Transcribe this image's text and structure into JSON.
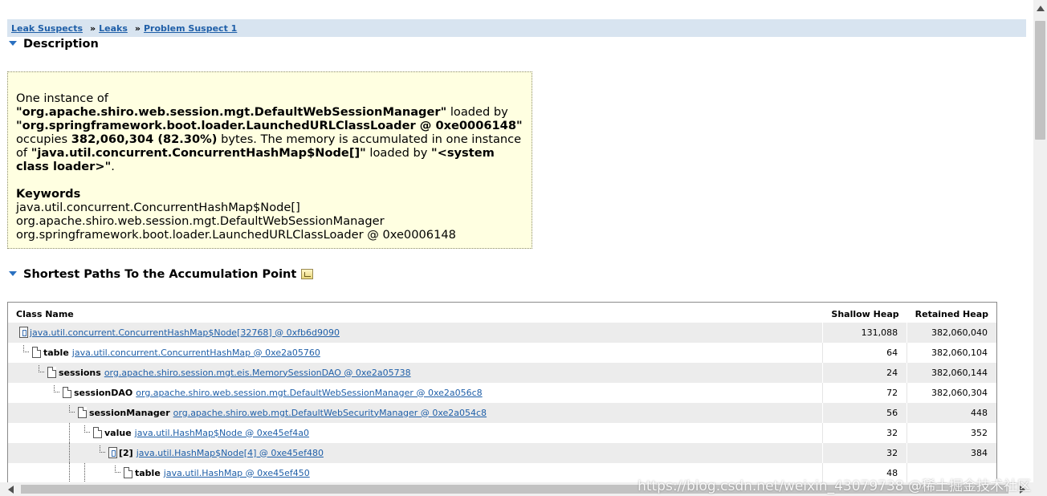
{
  "breadcrumb": {
    "items": [
      "Leak Suspects",
      "Leaks",
      "Problem Suspect 1"
    ],
    "separator": "»"
  },
  "description": {
    "title": "Description",
    "p1": {
      "t1": "One instance of ",
      "b1": "\"org.apache.shiro.web.session.mgt.DefaultWebSessionManager\"",
      "t2": " loaded by ",
      "b2": "\"org.springframework.boot.loader.LaunchedURLClassLoader @ 0xe0006148\"",
      "t3": " occupies ",
      "b3": "382,060,304 (82.30%)",
      "t4": " bytes. The memory is accumulated in one instance of ",
      "b4": "\"java.util.concurrent.ConcurrentHashMap$Node[]\"",
      "t5": " loaded by ",
      "b5": "\"<system class loader>\"",
      "t6": "."
    },
    "keywords_title": "Keywords",
    "keywords": [
      "java.util.concurrent.ConcurrentHashMap$Node[]",
      "org.apache.shiro.web.session.mgt.DefaultWebSessionManager",
      "org.springframework.boot.loader.LaunchedURLClassLoader @ 0xe0006148"
    ]
  },
  "paths": {
    "title": "Shortest Paths To the Accumulation Point",
    "icon": "export-icon",
    "columns": {
      "class_name": "Class Name",
      "shallow": "Shallow Heap",
      "retained": "Retained Heap"
    },
    "rows": [
      {
        "field": "",
        "link": "java.util.concurrent.ConcurrentHashMap$Node[32768] @ 0xfb6d9090",
        "shallow": "131,088",
        "retained": "382,060,040"
      },
      {
        "field": "table",
        "link": "java.util.concurrent.ConcurrentHashMap @ 0xe2a05760",
        "shallow": "64",
        "retained": "382,060,104"
      },
      {
        "field": "sessions",
        "link": "org.apache.shiro.session.mgt.eis.MemorySessionDAO @ 0xe2a05738",
        "shallow": "24",
        "retained": "382,060,144"
      },
      {
        "field": "sessionDAO",
        "link": "org.apache.shiro.web.session.mgt.DefaultWebSessionManager @ 0xe2a056c8",
        "shallow": "72",
        "retained": "382,060,304"
      },
      {
        "field": "sessionManager",
        "link": "org.apache.shiro.web.mgt.DefaultWebSecurityManager @ 0xe2a054c8",
        "shallow": "56",
        "retained": "448"
      },
      {
        "field": "value",
        "link": "java.util.HashMap$Node @ 0xe45ef4a0",
        "shallow": "32",
        "retained": "352"
      },
      {
        "field": "[2]",
        "link": "java.util.HashMap$Node[4] @ 0xe45ef480",
        "shallow": "32",
        "retained": "384"
      },
      {
        "field": "table",
        "link": "java.util.HashMap @ 0xe45ef450",
        "shallow": "48",
        "retained": ""
      }
    ]
  },
  "watermark": "https://blog.csdn.net/weixin_43079738 @稀土掘金技术社区",
  "colors": {
    "link": "#1f5fa8",
    "breadcrumb_bg": "#d8e4f0",
    "desc_bg": "#ffffe1",
    "row_alt": "#ececec"
  }
}
